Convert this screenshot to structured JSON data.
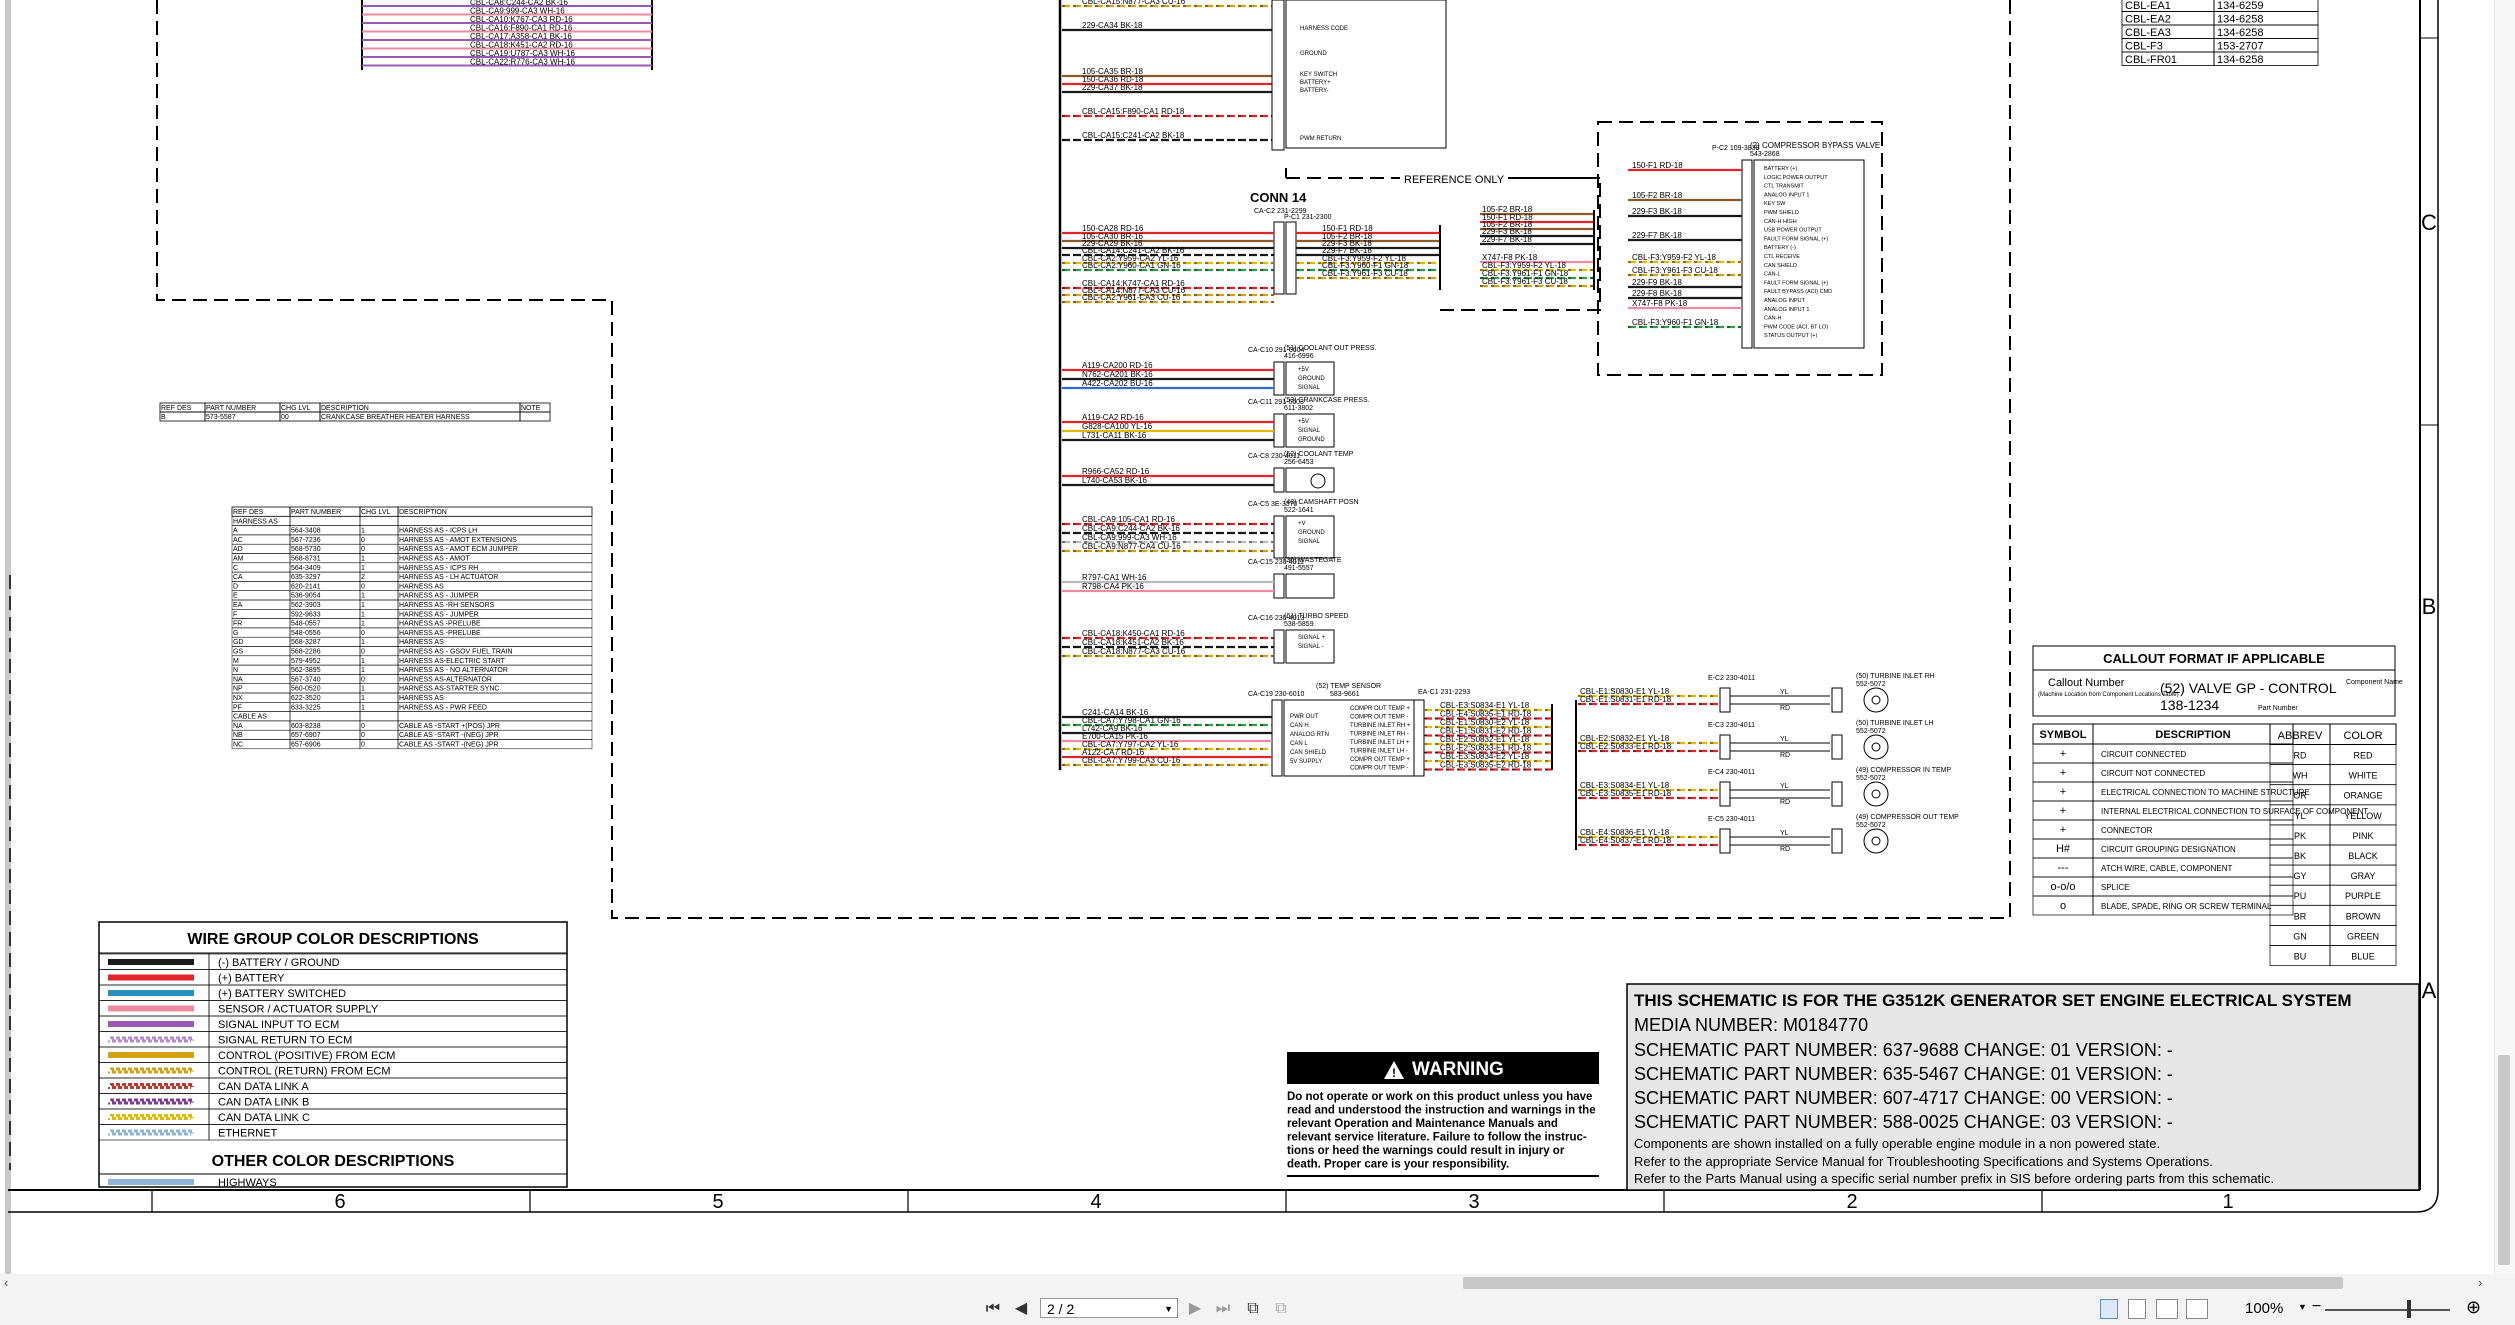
{
  "sheet": {
    "zone_columns": [
      "6",
      "5",
      "4",
      "3",
      "2",
      "1"
    ],
    "zone_rows": [
      "C",
      "B",
      "A"
    ]
  },
  "top_left_harness": {
    "wires": [
      "CBL-CA8:C244-CA2 BK-16",
      "CBL-CA9:999-CA3 WH-16",
      "CBL-CA10:K767-CA3 RD-16",
      "CBL-CA16:F890-CA1 RD-16",
      "CBL-CA17:A358-CA1 BK-16",
      "CBL-CA18:K451-CA2 RD-16",
      "CBL-CA19:U787-CA3 WH-16",
      "CBL-CA22:R776-CA3 WH-16"
    ]
  },
  "top_center_wires": {
    "wires": [
      "CBL-CA15:N877-CA3 CU-16",
      "229-CA34 BK-18",
      "105-CA35 BR-18",
      "150-CA36 RD-18",
      "229-CA37 BK-18",
      "CBL-CA15:F890-CA1 RD-18",
      "CBL-CA15:C241-CA2 BK-18"
    ],
    "pin_labels": [
      "HARNESS CODE",
      "GROUND",
      "KEY SWITCH",
      "BATTERY+",
      "BATTERY-",
      "PWM RETURN"
    ]
  },
  "crankcase_table": {
    "headers": [
      "REF DES",
      "PART NUMBER",
      "CHG LVL",
      "DESCRIPTION",
      "NOTE"
    ],
    "rows": [
      [
        "B",
        "573-5587",
        "00",
        "CRANKCASE BREATHER HEATER HARNESS",
        ""
      ]
    ]
  },
  "harness_table": {
    "headers": [
      "REF DES",
      "PART NUMBER",
      "CHG LVL",
      "DESCRIPTION"
    ],
    "rows": [
      [
        "HARNESS AS",
        "",
        "",
        ""
      ],
      [
        "A",
        "564-3408",
        "1",
        "HARNESS AS - ICPS LH"
      ],
      [
        "AC",
        "567-7236",
        "0",
        "HARNESS AS - AMOT EXTENSIONS"
      ],
      [
        "AD",
        "568-5730",
        "0",
        "HARNESS AS - AMOT ECM JUMPER"
      ],
      [
        "AM",
        "568-8731",
        "1",
        "HARNESS AS - AMOT"
      ],
      [
        "C",
        "564-3409",
        "1",
        "HARNESS AS - ICPS RH"
      ],
      [
        "CA",
        "635-3297",
        "2",
        "HARNESS AS - LH ACTUATOR"
      ],
      [
        "D",
        "620-2141",
        "0",
        "HARNESS AS"
      ],
      [
        "E",
        "536-9054",
        "1",
        "HARNESS AS - JUMPER"
      ],
      [
        "EA",
        "562-3903",
        "1",
        "HARNESS AS -RH SENSORS"
      ],
      [
        "F",
        "592-9633",
        "1",
        "HARNESS AS - JUMPER"
      ],
      [
        "FR",
        "548-0557",
        "1",
        "HARNESS AS -PRELUBE"
      ],
      [
        "G",
        "548-0556",
        "0",
        "HARNESS AS -PRELUBE"
      ],
      [
        "GD",
        "568-3287",
        "1",
        "HARNESS AS"
      ],
      [
        "GS",
        "568-2286",
        "0",
        "HARNESS AS - GSOV FUEL TRAIN"
      ],
      [
        "M",
        "579-4952",
        "1",
        "HARNESS AS-ELECTRIC START"
      ],
      [
        "N",
        "562-3895",
        "1",
        "HARNESS AS - NO ALTERNATOR"
      ],
      [
        "NA",
        "567-3740",
        "0",
        "HARNESS AS-ALTERNATOR"
      ],
      [
        "NP",
        "560-0520",
        "1",
        "HARNESS AS-STARTER SYNC"
      ],
      [
        "NX",
        "622-3520",
        "1",
        "HARNESS AS"
      ],
      [
        "PF",
        "633-3225",
        "1",
        "HARNESS AS - PWR FEED"
      ],
      [
        "CABLE AS",
        "",
        "",
        ""
      ],
      [
        "NA",
        "603-8238",
        "0",
        "CABLE AS -START +(POS) JPR"
      ],
      [
        "NB",
        "657-6907",
        "0",
        "CABLE AS -START -(NEG) JPR"
      ],
      [
        "NC",
        "657-6906",
        "0",
        "CABLE AS -START -(NEG) JPR"
      ]
    ]
  },
  "wire_group": {
    "title": "WIRE GROUP COLOR DESCRIPTIONS",
    "items": [
      {
        "label": "(-) BATTERY / GROUND",
        "color": "#1a1a1a",
        "pattern": "solid"
      },
      {
        "label": "(+) BATTERY",
        "color": "#e0262a",
        "pattern": "solid"
      },
      {
        "label": "(+) BATTERY SWITCHED",
        "color": "#2a8fb8",
        "pattern": "solid"
      },
      {
        "label": "SENSOR / ACTUATOR SUPPLY",
        "color": "#f08aa0",
        "pattern": "solid"
      },
      {
        "label": "SIGNAL INPUT TO ECM",
        "color": "#9b59b6",
        "pattern": "solid"
      },
      {
        "label": "SIGNAL RETURN TO ECM",
        "color": "#b48ac8",
        "pattern": "striped"
      },
      {
        "label": "CONTROL (POSITIVE) FROM ECM",
        "color": "#d4a017",
        "pattern": "solid"
      },
      {
        "label": "CONTROL (RETURN) FROM ECM",
        "color": "#d4a017",
        "pattern": "striped"
      },
      {
        "label": "CAN DATA LINK A",
        "color": "#c0392b",
        "pattern": "striped"
      },
      {
        "label": "CAN DATA LINK B",
        "color": "#7d3c98",
        "pattern": "striped"
      },
      {
        "label": "CAN DATA LINK C",
        "color": "#e6b800",
        "pattern": "striped"
      },
      {
        "label": "ETHERNET",
        "color": "#8fb3d9",
        "pattern": "striped"
      }
    ],
    "other_title": "OTHER COLOR DESCRIPTIONS",
    "other_items": [
      {
        "label": "HIGHWAYS",
        "color": "#8fb3d9",
        "pattern": "solid"
      }
    ]
  },
  "conn14": {
    "title": "CONN 14",
    "sub_left": "CA-C2 231-2299",
    "sub_right": "P-C1 231-2300",
    "left_wires": [
      "150-CA28 RD-16",
      "105-CA30 BR-16",
      "229-CA29 BK-16",
      "CBL-CA14:C241-CA2 BK-16",
      "CBL-CA2:Y959-CA2 YL-16",
      "CBL-CA2:Y960-CA1 GN-16",
      "CBL-CA14:K747-CA1 RD-16",
      "CBL-CA14:N877-CA3 CU-16",
      "CBL-CA2:Y961-CA3 CU-16"
    ],
    "right_wires": [
      "150-F1 RD-18",
      "105-F2 BR-18",
      "229-F3 BK-18",
      "229-F7 BK-18",
      "CBL-F3:Y959-F2 YL-18",
      "CBL-F3:Y960-F1 GN-18",
      "CBL-F3:Y961-F3 CU-18"
    ]
  },
  "reference_only": {
    "label": "REFERENCE ONLY",
    "wires": [
      "105-F2 BR-18",
      "150-F1 RD-18",
      "105-F2 BR-18",
      "229-F3 BK-18",
      "229-F7 BK-18",
      "X747-F8 PK-18",
      "CBL-F3:Y959-F2 YL-18",
      "CBL-F3:Y961-F1 GN-18",
      "CBL-F3:Y961-F3 CU-18"
    ]
  },
  "compressor_bypass": {
    "title": "(2) COMPRESSOR BYPASS VALVE",
    "part": "543-2868",
    "conn": "P-C2 109-3838",
    "wires": [
      "150-F1 RD-18",
      "105-F2 BR-18",
      "229-F3 BK-18",
      "229-F7 BK-18",
      "CBL-F3:Y959-F2 YL-18",
      "CBL-F3:Y961-F3 CU-18",
      "229-F9 BK-18",
      "229-F8 BK-18",
      "X747-F8 PK-18",
      "CBL-F3:Y960-F1 GN-18"
    ],
    "pins": [
      "BATTERY (+)",
      "LOGIC POWER OUTPUT",
      "CTL TRANSMIT",
      "ANALOG INPUT 1",
      "KEY SW",
      "PWM SHIELD",
      "CAN-H HIGH",
      "USB POWER OUTPUT",
      "FAULT FORM SIGNAL (+)",
      "BATTERY (-)",
      "CTL RECEIVE",
      "CAN SHIELD",
      "CAN-L",
      "FAULT FORM SIGNAL (+)",
      "FAULT BYPASS (ACI) CMD",
      "ANALOG INPUT",
      "ANALOG INPUT 1",
      "CAN-H",
      "PWM CODE (ACI, BT LO)",
      "STATUS OUTPUT (+)"
    ]
  },
  "sensors": [
    {
      "id": "coolant-outlet",
      "conn": "CA-C10 291-6604",
      "title": "(51) COOLANT OUT PRESS.",
      "part": "416-6996",
      "wires": [
        "A119-CA200 RD-16",
        "N762-CA201 BK-16",
        "A422-CA202 BU-16"
      ],
      "pins": [
        "+5V",
        "GROUND",
        "SIGNAL"
      ]
    },
    {
      "id": "crankcase",
      "conn": "CA-C11 291-6603",
      "title": "(53) CRANKCASE PRESS.",
      "part": "611-3802",
      "wires": [
        "A119-CA2 RD-16",
        "G828-CA100 YL-16",
        "L731-CA11 BK-16"
      ],
      "pins": [
        "+5V",
        "SIGNAL",
        "GROUND"
      ]
    },
    {
      "id": "coolant-temp",
      "conn": "CA-C8 230-4011",
      "title": "(52) COOLANT TEMP",
      "part": "256-6453",
      "wires": [
        "R966-CA52 RD-16",
        "L740-CA53 BK-16"
      ],
      "pins": [
        "",
        ""
      ]
    },
    {
      "id": "camshaft",
      "conn": "CA-C5 3E-3370",
      "title": "(48) CAMSHAFT POSN",
      "part": "522-1641",
      "wires": [
        "CBL-CA9:105-CA1 RD-16",
        "CBL-CA9:C244-CA2 BK-16",
        "CBL-CA9:999-CA3 WH-16",
        "CBL-CA9:N877-CA4 CU-16"
      ],
      "pins": [
        "+V",
        "GROUND",
        "SIGNAL"
      ]
    },
    {
      "id": "wastegate",
      "conn": "CA-C15 230-4011",
      "title": "(36) WASTEGATE",
      "part": "491-5557",
      "wires": [
        "R797-CA1 WH-16",
        "R798-CA4 PK-16"
      ],
      "pins": [
        "",
        ""
      ]
    },
    {
      "id": "turbo-speed",
      "conn": "CA-C16 230-4013",
      "title": "(61) TURBO SPEED",
      "part": "538-5859",
      "wires": [
        "CBL-CA18:K450-CA1 RD-16",
        "CBL-CA18:K451-CA2 BK-16",
        "CBL-CA18:N877-CA3 CU-16"
      ],
      "pins": [
        "SIGNAL +",
        "SIGNAL -"
      ]
    }
  ],
  "temp_sensor": {
    "conn": "CA-C19 230-6010",
    "title": "(52) TEMP SENSOR",
    "part": "583-9661",
    "conn2": "EA-C1 231-2293",
    "left_wires": [
      "C241-CA14 BK-16",
      "CBL-CA7:Y798-CA1 GN-16",
      "L742-CA9 BK-16",
      "E700-CA15 PK-16",
      "CBL-CA7:Y797-CA2 YL-16",
      "A122-CA7 RD-16",
      "CBL-CA7:Y799-CA3 CU-16"
    ],
    "pins_left": [
      "PWR OUT",
      "CAN H",
      "ANALOG RTN",
      "CAN L",
      "CAN SHIELD",
      "5V SUPPLY"
    ],
    "pins_right": [
      "COMPR OUT TEMP +",
      "COMPR OUT TEMP -",
      "TURBINE INLET RH +",
      "TURBINE INLET RH -",
      "TURBINE INLET LH +",
      "TURBINE INLET LH -",
      "COMPR OUT TEMP +",
      "COMPR OUT TEMP -"
    ],
    "right_wires": [
      "CBL-E3:S0834-E1 YL-18",
      "CBL-E4:S0835-E1 RD-18",
      "CBL-E1:S0830-E2 YL-18",
      "CBL-E1:S0831-E2 RD-18",
      "CBL-E2:S0832-E1 YL-18",
      "CBL-E2:S0833-E1 RD-18",
      "CBL-E3:S0834-E2 YL-18",
      "CBL-E3:S0835-E2 RD-18"
    ]
  },
  "thermocouples": [
    {
      "conn": "E-C2 230-4011",
      "wires": [
        "CBL-E1:S0830-E1 YL-18",
        "CBL-E1:S0831-E1 RD-18"
      ],
      "title": "(50) TURBINE INLET RH",
      "part": "552-5072"
    },
    {
      "conn": "E-C3 230-4011",
      "wires": [
        "CBL-E2:S0832-E1 YL-18",
        "CBL-E2:S0833-E1 RD-18"
      ],
      "title": "(50) TURBINE INLET LH",
      "part": "552-5072"
    },
    {
      "conn": "E-C4 230-4011",
      "wires": [
        "CBL-E3:S0834-E1 YL-18",
        "CBL-E3:S0835-E1 RD-18"
      ],
      "title": "(49) COMPRESSOR IN TEMP",
      "part": "552-5072"
    },
    {
      "conn": "E-C5 230-4011",
      "wires": [
        "CBL-E4:S0836-E1 YL-18",
        "CBL-E4:S0837-E1 RD-18"
      ],
      "title": "(49) COMPRESSOR OUT TEMP",
      "part": "552-5072"
    }
  ],
  "tc_pins": [
    "YL",
    "RD"
  ],
  "cable_table": {
    "rows": [
      [
        "CBL-EA1",
        "134-6259"
      ],
      [
        "CBL-EA2",
        "134-6258"
      ],
      [
        "CBL-EA3",
        "134-6258"
      ],
      [
        "CBL-F3",
        "153-2707"
      ],
      [
        "CBL-FR01",
        "134-6258"
      ]
    ]
  },
  "callout": {
    "title": "CALLOUT FORMAT IF APPLICABLE",
    "callout_number": "Callout Number",
    "callout_note": "(Machine Location from Component Locations Table)",
    "example_line1": "(52) VALVE GP - CONTROL",
    "example_line2": "138-1234",
    "component_name": "Component Name",
    "part_number": "Part Number"
  },
  "symbols": {
    "headers": [
      "SYMBOL",
      "DESCRIPTION"
    ],
    "rows": [
      [
        "+",
        "CIRCUIT CONNECTED"
      ],
      [
        "+",
        "CIRCUIT NOT CONNECTED"
      ],
      [
        "+",
        "ELECTRICAL CONNECTION TO MACHINE STRUCTURE"
      ],
      [
        "+",
        "INTERNAL ELECTRICAL CONNECTION TO SURFACE OF COMPONENT"
      ],
      [
        "+",
        "CONNECTOR"
      ],
      [
        "H#",
        "CIRCUIT GROUPING DESIGNATION"
      ],
      [
        "---",
        "ATCH WIRE, CABLE, COMPONENT"
      ],
      [
        "o-o/o",
        "SPLICE"
      ],
      [
        "o",
        "BLADE, SPADE, RING OR SCREW TERMINAL"
      ]
    ]
  },
  "colors": {
    "headers": [
      "ABBREV",
      "COLOR"
    ],
    "rows": [
      [
        "RD",
        "RED"
      ],
      [
        "WH",
        "WHITE"
      ],
      [
        "OR",
        "ORANGE"
      ],
      [
        "YL",
        "YELLOW"
      ],
      [
        "PK",
        "PINK"
      ],
      [
        "BK",
        "BLACK"
      ],
      [
        "GY",
        "GRAY"
      ],
      [
        "PU",
        "PURPLE"
      ],
      [
        "BR",
        "BROWN"
      ],
      [
        "GN",
        "GREEN"
      ],
      [
        "BU",
        "BLUE"
      ]
    ]
  },
  "warning": {
    "title": "WARNING",
    "lines": [
      "Do not operate or work on this product unless you have",
      "read and understood the instruction and warnings in the",
      "relevant Operation and Maintenance Manuals and",
      "relevant service literature. Failure to follow the instruc-",
      "tions or heed the warnings could result in injury or",
      "death. Proper care is your responsibility."
    ]
  },
  "title_block": {
    "line1": "THIS SCHEMATIC IS FOR THE G3512K GENERATOR SET ENGINE ELECTRICAL SYSTEM",
    "line2": "MEDIA NUMBER: M0184770",
    "line3": "SCHEMATIC PART NUMBER: 637-9688 CHANGE: 01 VERSION: -",
    "line4": "SCHEMATIC PART NUMBER: 635-5467 CHANGE: 01 VERSION: -",
    "line5": "SCHEMATIC PART NUMBER: 607-4717 CHANGE: 00 VERSION: -",
    "line6": "SCHEMATIC PART NUMBER: 588-0025 CHANGE: 03 VERSION: -",
    "line7": "Components are shown installed on a fully operable engine module in a non powered state.",
    "line8": "Refer to the appropriate Service Manual for Troubleshooting Specifications and Systems Operations.",
    "line9": "Refer to the Parts Manual using a specific serial number prefix in SIS before ordering parts from this schematic."
  },
  "viewer": {
    "page": "2 / 2",
    "zoom": "100%"
  }
}
